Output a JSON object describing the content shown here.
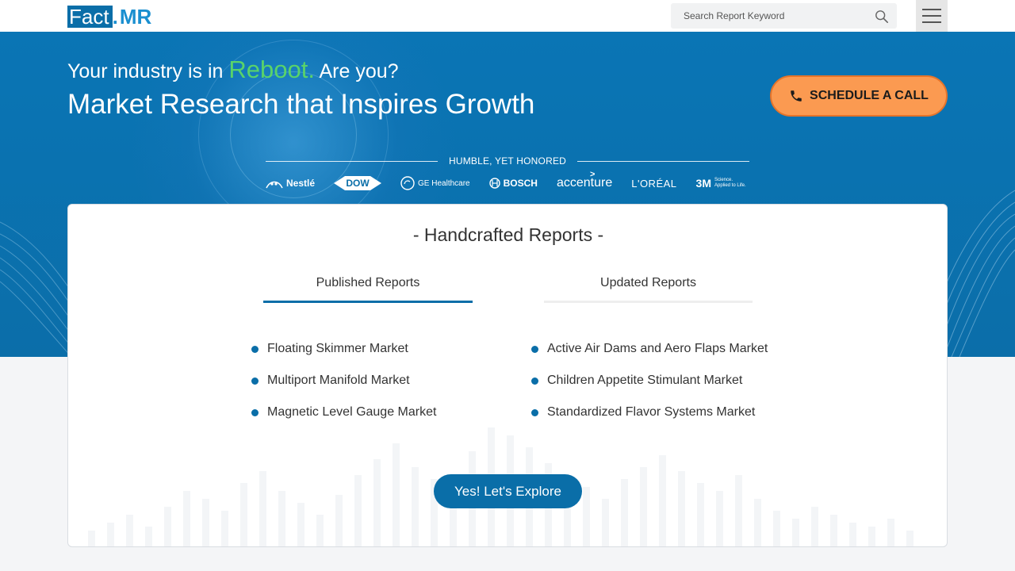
{
  "header": {
    "logo_fact": "Fact",
    "logo_dot": ".",
    "logo_mr": "MR",
    "search_placeholder": "Search Report Keyword"
  },
  "hero": {
    "tagline_before": "Your industry is in ",
    "tagline_highlight": "Reboot.",
    "tagline_after": " Are you?",
    "headline": "Market Research that Inspires Growth",
    "cta_label": "SCHEDULE A CALL",
    "honored_label": "HUMBLE, YET HONORED",
    "clients": [
      {
        "name": "Nestlé",
        "icon": "nestle-nest-icon"
      },
      {
        "name": "DOW",
        "icon": "dow-diamond-icon"
      },
      {
        "name": "GE Healthcare",
        "icon": "ge-monogram-icon"
      },
      {
        "name": "BOSCH",
        "icon": "bosch-armature-icon"
      },
      {
        "name": "accenture",
        "icon": "accenture-chevron-icon"
      },
      {
        "name": "L'ORÉAL",
        "icon": ""
      },
      {
        "name": "3M",
        "tagline": "Science. Applied to Life.",
        "icon": ""
      }
    ]
  },
  "reports": {
    "title": "- Handcrafted Reports -",
    "tabs": [
      {
        "label": "Published Reports",
        "active": true
      },
      {
        "label": "Updated Reports",
        "active": false
      }
    ],
    "published": [
      "Floating Skimmer Market",
      "Multiport Manifold Market",
      "Magnetic Level Gauge Market"
    ],
    "updated": [
      "Active Air Dams and Aero Flaps Market",
      "Children Appetite Stimulant Market",
      "Standardized Flavor Systems Market"
    ],
    "explore_label": "Yes! Let's Explore"
  },
  "colors": {
    "brand_blue": "#0a6ea8",
    "hero_blue": "#0a75b5",
    "reboot_green": "#59d36a",
    "cta_orange": "#fb9a51",
    "tab_inactive": "#eeeeee"
  }
}
